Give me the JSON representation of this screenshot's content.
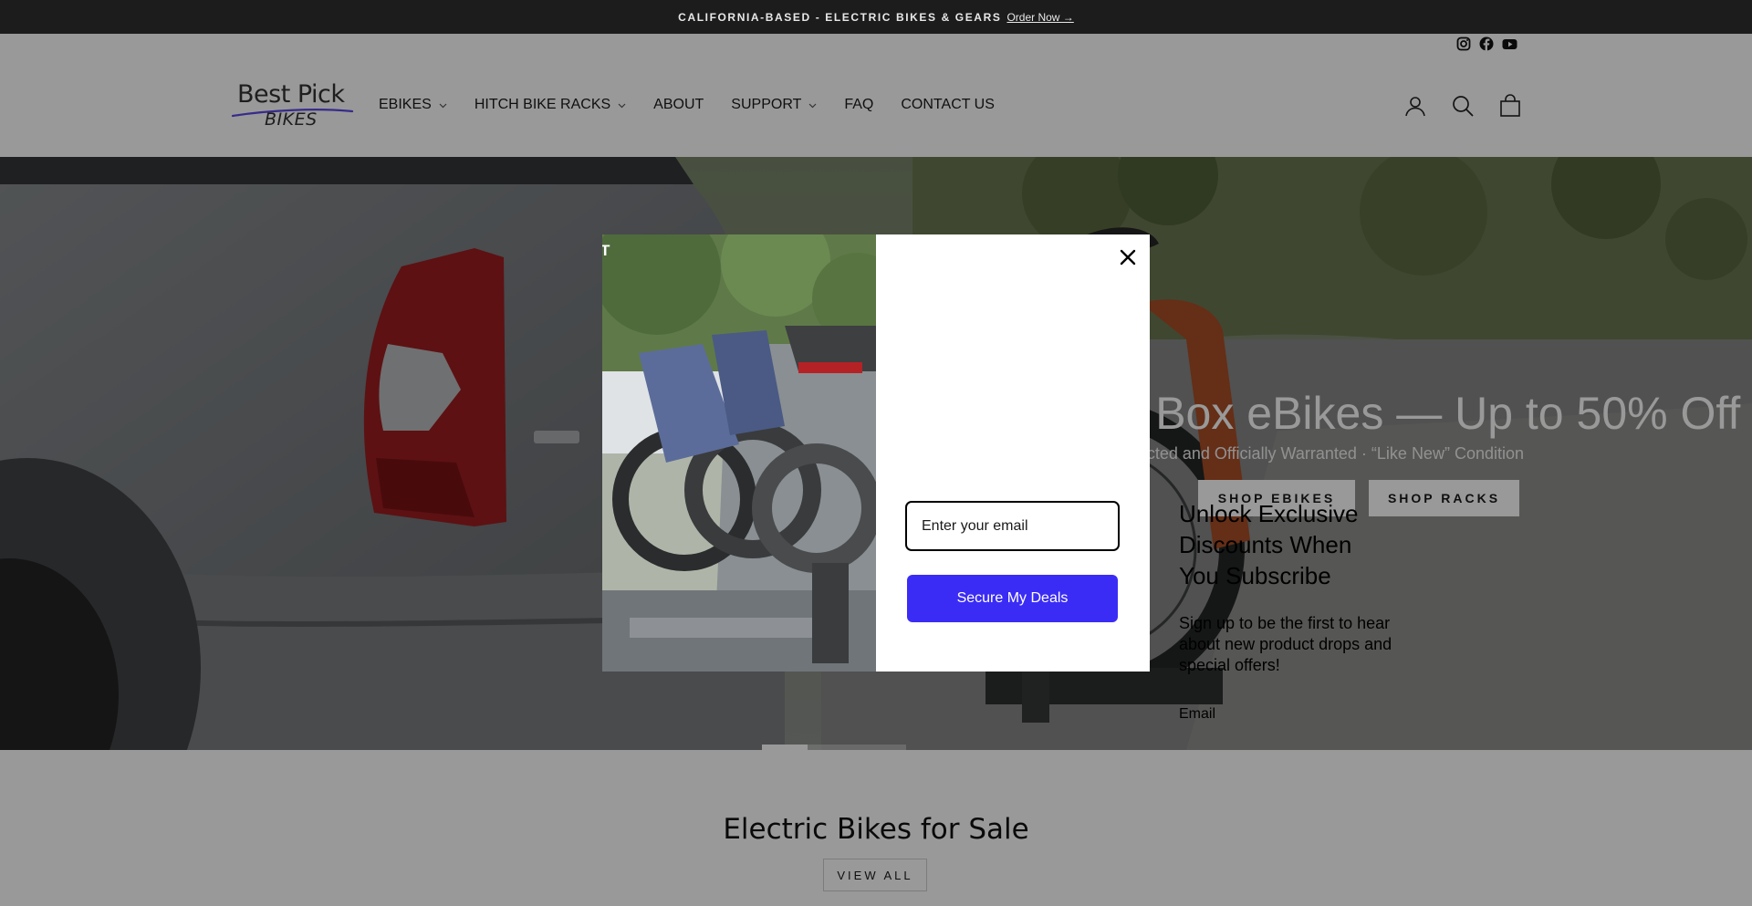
{
  "announcement": {
    "text": "CALIFORNIA-BASED - ELECTRIC BIKES & GEARS",
    "link": "Order Now →"
  },
  "header": {
    "logo_line1": "Best Pick",
    "logo_line2": "BIKES",
    "social_icons": [
      "instagram-icon",
      "facebook-icon",
      "youtube-icon"
    ],
    "nav": [
      "EBIKES",
      "HITCH BIKE RACKS",
      "ABOUT",
      "SUPPORT",
      "FAQ",
      "CONTACT US"
    ],
    "nav_dropdowns": [
      true,
      true,
      false,
      true,
      false,
      false
    ],
    "icons": [
      "account-icon",
      "search-icon",
      "cart-icon"
    ]
  },
  "hero": {
    "heading": "Open Box eBikes — Up to 50% Off",
    "subheading": "Fully Inspected and Officially Warranted · “Like New” Condition",
    "button_ebikes": "SHOP EBIKES",
    "button_racks": "SHOP RACKS",
    "slide_count": 5,
    "active_slide": 1
  },
  "section": {
    "title": "Electric Bikes for Sale",
    "view_all": "VIEW ALL"
  },
  "popup": {
    "title": "Unlock Exclusive Discounts When You Subscribe",
    "description": "Sign up to be the first to hear about new product drops and special offers!",
    "email_label": "Email",
    "email_placeholder": "Enter your email",
    "submit_label": "Secure My Deals",
    "image_text": "T",
    "close_icon": "close-icon"
  },
  "colors": {
    "accent": "#3b2cf5",
    "announcement_bg": "#1c1c1c",
    "overlay": "rgba(0,0,0,0.40)"
  }
}
